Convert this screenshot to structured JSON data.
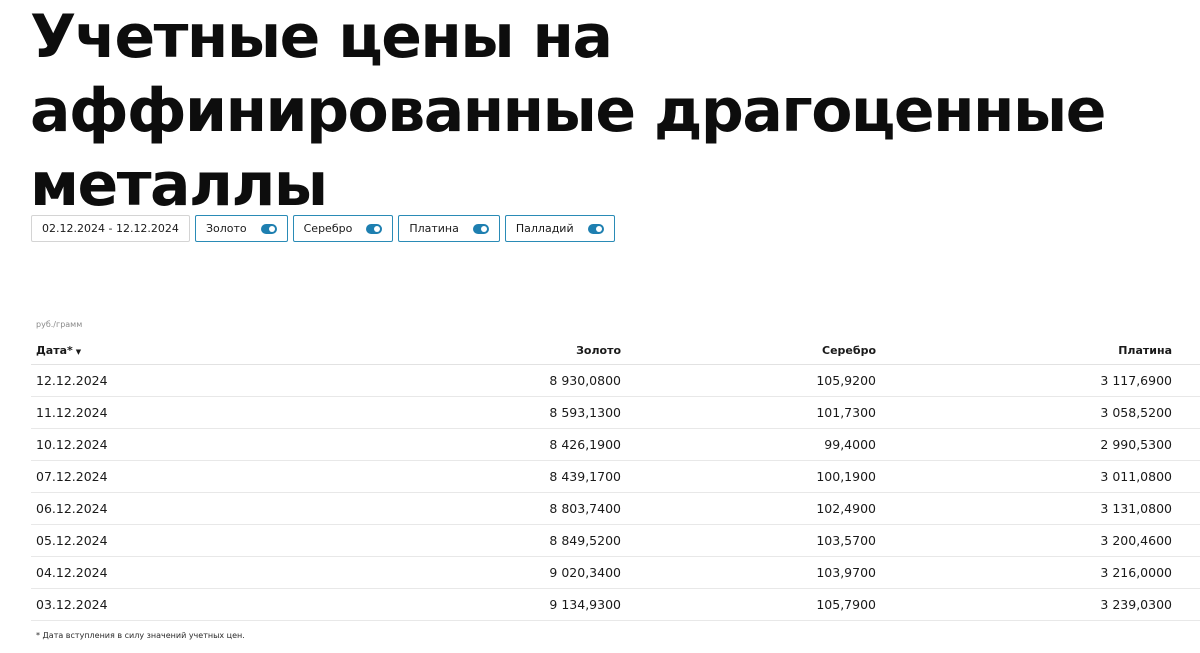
{
  "page": {
    "title": "Учетные цены на аффинированные драгоценные металлы"
  },
  "filters": {
    "date_range": "02.12.2024 - 12.12.2024",
    "metals": [
      {
        "label": "Золото",
        "enabled": true
      },
      {
        "label": "Серебро",
        "enabled": true
      },
      {
        "label": "Платина",
        "enabled": true
      },
      {
        "label": "Палладий",
        "enabled": true
      }
    ]
  },
  "table": {
    "unit": "руб./грамм",
    "headers": {
      "date": "Дата*",
      "sort_indicator": "▼",
      "gold": "Золото",
      "silver": "Серебро",
      "platinum": "Платина"
    },
    "rows": [
      {
        "date": "12.12.2024",
        "gold": "8 930,0800",
        "silver": "105,9200",
        "platinum": "3 117,6900"
      },
      {
        "date": "11.12.2024",
        "gold": "8 593,1300",
        "silver": "101,7300",
        "platinum": "3 058,5200"
      },
      {
        "date": "10.12.2024",
        "gold": "8 426,1900",
        "silver": "99,4000",
        "platinum": "2 990,5300"
      },
      {
        "date": "07.12.2024",
        "gold": "8 439,1700",
        "silver": "100,1900",
        "platinum": "3 011,0800"
      },
      {
        "date": "06.12.2024",
        "gold": "8 803,7400",
        "silver": "102,4900",
        "platinum": "3 131,0800"
      },
      {
        "date": "05.12.2024",
        "gold": "8 849,5200",
        "silver": "103,5700",
        "platinum": "3 200,4600"
      },
      {
        "date": "04.12.2024",
        "gold": "9 020,3400",
        "silver": "103,9700",
        "platinum": "3 216,0000"
      },
      {
        "date": "03.12.2024",
        "gold": "9 134,9300",
        "silver": "105,7900",
        "platinum": "3 239,0300"
      }
    ],
    "footnote": "* Дата вступления в силу значений учетных цен."
  },
  "colors": {
    "accent": "#1e7fb0",
    "chip_border": "#2a8bb6"
  }
}
